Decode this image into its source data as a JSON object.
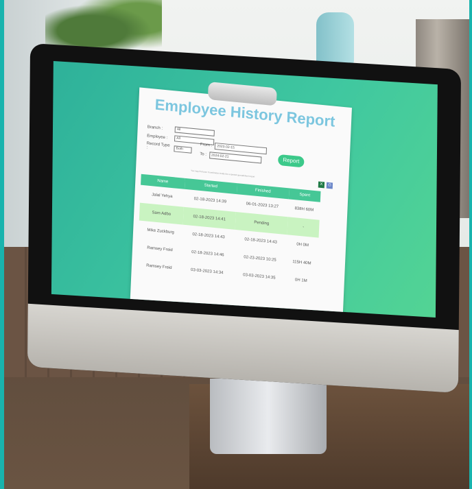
{
  "report": {
    "title": "Employee History Report",
    "labels": {
      "branch": "Branch :",
      "employee": "Employee :",
      "record_type": "Record Type :",
      "from": "From :",
      "to": "To :"
    },
    "filters": {
      "branch": "All",
      "employee": "All",
      "record_type": "Both",
      "from": "2023-02-15",
      "to": "2024-02-21"
    },
    "button": "Report",
    "note": "You may find your Coordinates inside the exported spreadsheet report",
    "icons": {
      "excel": "excel-icon",
      "print": "printer-icon"
    },
    "columns": [
      "Name",
      "Started",
      "Finished",
      "Spent"
    ],
    "rows": [
      {
        "name": "Jalal Yehya",
        "started": "02-18-2023 14:39",
        "finished": "06-01-2023 13:27",
        "spent": "838H 60M"
      },
      {
        "name": "Sam Adbo",
        "started": "02-18-2023 14:41",
        "finished": "Pending",
        "spent": "-"
      },
      {
        "name": "Mike Zuckburg",
        "started": "02-18-2023 14:43",
        "finished": "02-18-2023 14:43",
        "spent": "0H 0M"
      },
      {
        "name": "Ramsey Freid",
        "started": "02-18-2023 14:46",
        "finished": "02-23-2023 10:25",
        "spent": "115H 40M"
      },
      {
        "name": "Ramsey Freid",
        "started": "03-03-2023 14:34",
        "finished": "03-03-2023 14:35",
        "spent": "0H 1M"
      }
    ]
  },
  "colors": {
    "screen_bg": "#3fc7a0",
    "header_bg": "#46c796",
    "highlight_row": "#c9f3c1",
    "title": "#7cc6df",
    "button": "#3cc98a"
  }
}
